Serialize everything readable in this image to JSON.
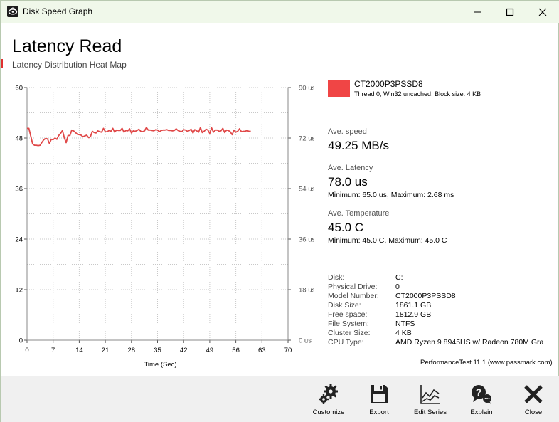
{
  "window": {
    "title": "Disk Speed Graph"
  },
  "header": {
    "title": "Latency Read",
    "subtitle": "Latency Distribution Heat Map"
  },
  "chart_data": {
    "type": "line",
    "xlabel": "Time (Sec)",
    "x_ticks": [
      "0",
      "7",
      "14",
      "21",
      "28",
      "35",
      "42",
      "49",
      "56",
      "63",
      "70"
    ],
    "xlim": [
      0,
      70
    ],
    "y_left_ticks": [
      "0",
      "12",
      "24",
      "36",
      "48",
      "60"
    ],
    "ylim_left": [
      0,
      60
    ],
    "y_right_ticks": [
      "0 us",
      "18 us",
      "36 us",
      "54 us",
      "72 us",
      "90 us"
    ],
    "ylim_right": [
      0,
      90
    ],
    "grid": true,
    "series": [
      {
        "name": "CT2000P3PSSD8",
        "color": "#e04848",
        "x": [
          0,
          0.5,
          1,
          1.5,
          2,
          2.5,
          3,
          3.5,
          4,
          4.5,
          5,
          5.5,
          6,
          6.5,
          7,
          7.5,
          8,
          8.5,
          9,
          9.5,
          10,
          10.5,
          11,
          11.5,
          12,
          12.5,
          13,
          13.5,
          14,
          14.5,
          15,
          15.5,
          16,
          16.5,
          17,
          17.5,
          18,
          18.5,
          19,
          19.5,
          20,
          20.5,
          21,
          21.5,
          22,
          22.5,
          23,
          23.5,
          24,
          24.5,
          25,
          25.5,
          26,
          26.5,
          27,
          27.5,
          28,
          28.5,
          29,
          29.5,
          30,
          30.5,
          31,
          31.5,
          32,
          32.5,
          33,
          33.5,
          34,
          34.5,
          35,
          35.5,
          36,
          36.5,
          37,
          37.5,
          38,
          38.5,
          39,
          39.5,
          40,
          40.5,
          41,
          41.5,
          42,
          42.5,
          43,
          43.5,
          44,
          44.5,
          45,
          45.5,
          46,
          46.5,
          47,
          47.5,
          48,
          48.5,
          49,
          49.5,
          50,
          50.5,
          51,
          51.5,
          52,
          52.5,
          53,
          53.5,
          54,
          54.5,
          55,
          55.5,
          56,
          56.5,
          57,
          57.5,
          58,
          58.5,
          59,
          59.5,
          60
        ],
        "y": [
          50.3,
          50.3,
          48.5,
          46.6,
          46.3,
          46.3,
          46.2,
          46.3,
          47.0,
          47.6,
          47.9,
          47.8,
          46.7,
          47.7,
          47.6,
          48.0,
          47.7,
          48.6,
          49.1,
          49.8,
          48.1,
          46.9,
          48.6,
          48.6,
          49.9,
          49.7,
          49.3,
          48.9,
          48.8,
          48.7,
          48.3,
          48.5,
          48.7,
          48.1,
          48.3,
          49.6,
          49.3,
          49.2,
          49.7,
          49.5,
          49.4,
          50.3,
          49.5,
          49.5,
          49.8,
          49.6,
          50.3,
          49.4,
          49.9,
          49.8,
          49.8,
          50.3,
          49.4,
          49.8,
          49.7,
          50.2,
          49.2,
          49.7,
          49.6,
          49.8,
          50.1,
          49.6,
          49.5,
          49.7,
          50.5,
          49.9,
          49.9,
          49.8,
          49.7,
          50.0,
          49.9,
          49.5,
          49.8,
          49.9,
          49.9,
          50.0,
          49.8,
          49.8,
          49.7,
          49.8,
          50.2,
          49.8,
          49.6,
          49.5,
          50.0,
          49.9,
          49.6,
          49.8,
          50.1,
          49.2,
          50.0,
          49.7,
          49.4,
          50.5,
          49.3,
          49.6,
          50.1,
          49.9,
          49.1,
          50.4,
          49.4,
          49.9,
          49.9,
          49.6,
          49.7,
          50.3,
          49.3,
          49.9,
          49.8,
          49.5,
          48.8,
          49.9,
          49.4,
          49.6,
          50.2,
          49.5,
          49.6,
          49.6,
          49.8,
          49.6,
          49.6
        ]
      }
    ]
  },
  "legend": {
    "name": "CT2000P3PSSD8",
    "description": "Thread 0; Win32 uncached; Block size: 4 KB",
    "color": "#f04545"
  },
  "stats": {
    "speed_label": "Ave. speed",
    "speed_value": "49.25 MB/s",
    "latency_label": "Ave. Latency",
    "latency_value": "78.0 us",
    "latency_minmax": "Minimum: 65.0 us, Maximum: 2.68 ms",
    "temp_label": "Ave. Temperature",
    "temp_value": "45.0 C",
    "temp_minmax": "Minimum: 45.0 C, Maximum: 45.0 C"
  },
  "disk_info": [
    {
      "key": "Disk:",
      "value": "C:"
    },
    {
      "key": "Physical Drive:",
      "value": "0"
    },
    {
      "key": "Model Number:",
      "value": "CT2000P3PSSD8"
    },
    {
      "key": "Disk Size:",
      "value": "1861.1 GB"
    },
    {
      "key": "Free space:",
      "value": "1812.9 GB"
    },
    {
      "key": "File System:",
      "value": "NTFS"
    },
    {
      "key": "Cluster Size:",
      "value": "4 KB"
    },
    {
      "key": "CPU Type:",
      "value": "AMD Ryzen 9 8945HS w/ Radeon 780M Gra"
    }
  ],
  "branding": "PerformanceTest 11.1 (www.passmark.com)",
  "toolbar": {
    "customize_label": "Customize",
    "export_label": "Export",
    "edit_series_label": "Edit Series",
    "explain_label": "Explain",
    "close_label": "Close"
  }
}
